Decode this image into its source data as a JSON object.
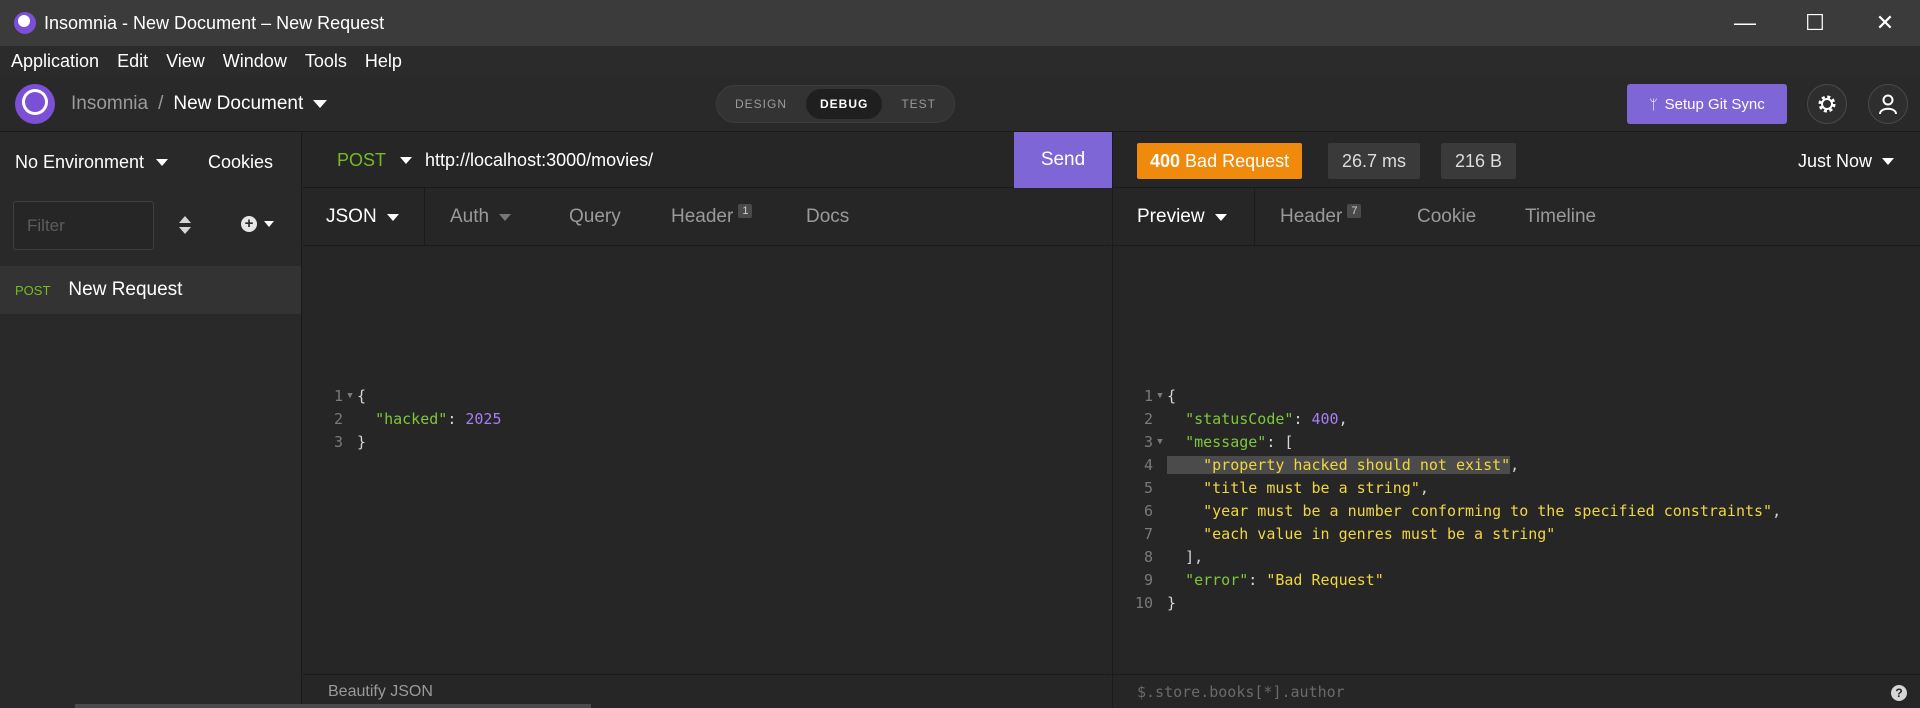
{
  "window": {
    "title": "Insomnia - New Document – New Request",
    "controls": {
      "minimize": "—",
      "maximize": "☐",
      "close": "✕"
    }
  },
  "menu": [
    "Application",
    "Edit",
    "View",
    "Window",
    "Tools",
    "Help"
  ],
  "header": {
    "workspace": "Insomnia",
    "separator": "/",
    "document": "New Document",
    "modes": [
      "DESIGN",
      "DEBUG",
      "TEST"
    ],
    "active_mode": "DEBUG",
    "git_sync_label": "Setup Git Sync",
    "icons": {
      "branch": "git-branch-icon",
      "settings": "gear-icon",
      "account": "user-icon"
    }
  },
  "sidebar": {
    "environment": "No Environment",
    "cookies": "Cookies",
    "filter_placeholder": "Filter",
    "requests": [
      {
        "method": "POST",
        "name": "New Request"
      }
    ]
  },
  "request": {
    "method": "POST",
    "url": "http://localhost:3000/movies/",
    "send_label": "Send",
    "tabs": [
      {
        "label": "JSON",
        "active": true
      },
      {
        "label": "Auth"
      },
      {
        "label": "Query"
      },
      {
        "label": "Header",
        "badge": "1"
      },
      {
        "label": "Docs"
      }
    ],
    "line_numbers": [
      "1",
      "2",
      "3"
    ],
    "body": {
      "open": "{",
      "key": "\"hacked\"",
      "colon": ": ",
      "value": "2025",
      "close": "}"
    },
    "beautify_label": "Beautify JSON"
  },
  "response": {
    "status_code": "400",
    "status_text": "Bad Request",
    "time": "26.7 ms",
    "size": "216 B",
    "timestamp": "Just Now",
    "tabs": [
      {
        "label": "Preview",
        "active": true
      },
      {
        "label": "Header",
        "badge": "7"
      },
      {
        "label": "Cookie"
      },
      {
        "label": "Timeline"
      }
    ],
    "line_numbers": [
      "1",
      "2",
      "3",
      "4",
      "5",
      "6",
      "7",
      "8",
      "9",
      "10"
    ],
    "body": {
      "open": "{",
      "status_key": "\"statusCode\"",
      "status_value": "400",
      "message_key": "\"message\"",
      "array_open": "[",
      "messages": [
        "\"property hacked should not exist\"",
        "\"title must be a string\"",
        "\"year must be a number conforming to the specified constraints\"",
        "\"each value in genres must be a string\""
      ],
      "array_close": "],",
      "error_key": "\"error\"",
      "error_value": "\"Bad Request\"",
      "close": "}"
    },
    "filter_placeholder": "$.store.books[*].author",
    "help": "?"
  },
  "colors": {
    "accent": "#7e66d6",
    "status_error": "#f08a0c",
    "method_post": "#75ba24",
    "json_string": "#f0d641",
    "json_number": "#a97df5"
  }
}
